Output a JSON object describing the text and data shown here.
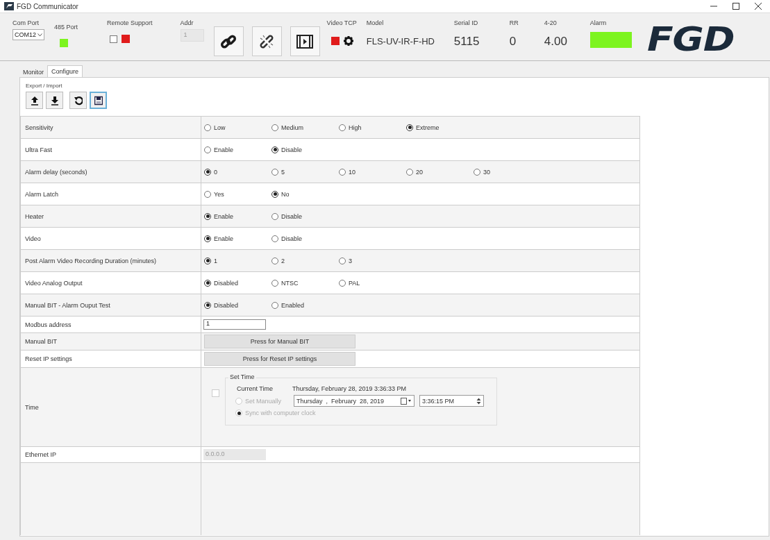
{
  "window": {
    "title": "FGD Communicator"
  },
  "toolbar": {
    "com_port": {
      "label": "Com Port",
      "value": "COM12"
    },
    "port_485": {
      "label": "485 Port",
      "on": true
    },
    "remote_support": {
      "label": "Remote Support",
      "checked": false,
      "on": false
    },
    "addr": {
      "label": "Addr",
      "value": "1",
      "disabled": true
    },
    "video_tcp": {
      "label": "Video TCP",
      "on": false
    },
    "model": {
      "label": "Model",
      "value": "FLS-UV-IR-F-HD"
    },
    "serial_id": {
      "label": "Serial ID",
      "value": "5115"
    },
    "rr": {
      "label": "RR",
      "value": "0"
    },
    "current": {
      "label": "4-20",
      "value": "4.00"
    },
    "alarm": {
      "label": "Alarm",
      "active": false
    },
    "logo": "FGD"
  },
  "tabs": [
    {
      "label": "Monitor",
      "selected": false
    },
    {
      "label": "Configure",
      "selected": true
    }
  ],
  "export_import": {
    "label": "Export / Import"
  },
  "settings": [
    {
      "kind": "radio",
      "label": "Sensitivity",
      "options": [
        {
          "label": "Low",
          "selected": false
        },
        {
          "label": "Medium",
          "selected": false
        },
        {
          "label": "High",
          "selected": false
        },
        {
          "label": "Extreme",
          "selected": true
        }
      ]
    },
    {
      "kind": "radio",
      "label": "Ultra Fast",
      "options": [
        {
          "label": "Enable",
          "selected": false
        },
        {
          "label": "Disable",
          "selected": true
        }
      ]
    },
    {
      "kind": "radio",
      "label": "Alarm delay (seconds)",
      "options": [
        {
          "label": "0",
          "selected": true
        },
        {
          "label": "5",
          "selected": false
        },
        {
          "label": "10",
          "selected": false
        },
        {
          "label": "20",
          "selected": false
        },
        {
          "label": "30",
          "selected": false
        }
      ]
    },
    {
      "kind": "radio",
      "label": "Alarm Latch",
      "options": [
        {
          "label": "Yes",
          "selected": false
        },
        {
          "label": "No",
          "selected": true
        }
      ]
    },
    {
      "kind": "radio",
      "label": "Heater",
      "options": [
        {
          "label": "Enable",
          "selected": true
        },
        {
          "label": "Disable",
          "selected": false
        }
      ]
    },
    {
      "kind": "radio",
      "label": "Video",
      "options": [
        {
          "label": "Enable",
          "selected": true
        },
        {
          "label": "Disable",
          "selected": false
        }
      ]
    },
    {
      "kind": "radio",
      "label": "Post Alarm Video Recording Duration (minutes)",
      "options": [
        {
          "label": "1",
          "selected": true
        },
        {
          "label": "2",
          "selected": false
        },
        {
          "label": "3",
          "selected": false
        }
      ]
    },
    {
      "kind": "radio",
      "label": "Video Analog Output",
      "options": [
        {
          "label": "Disabled",
          "selected": true
        },
        {
          "label": "NTSC",
          "selected": false
        },
        {
          "label": "PAL",
          "selected": false
        }
      ]
    },
    {
      "kind": "radio",
      "label": "Manual BIT - Alarm Ouput Test",
      "options": [
        {
          "label": "Disabled",
          "selected": true
        },
        {
          "label": "Enabled",
          "selected": false
        }
      ]
    },
    {
      "kind": "input",
      "label": "Modbus address",
      "value": "1"
    },
    {
      "kind": "button",
      "label": "Manual BIT",
      "button": "Press for Manual BIT"
    },
    {
      "kind": "button",
      "label": "Reset IP settings",
      "button": "Press for Reset IP settings"
    },
    {
      "kind": "time",
      "label": "Time",
      "checked": false,
      "group": "Set Time",
      "current_label": "Current Time",
      "current": "Thursday, February 28, 2019 3:36:33 PM",
      "manual": {
        "label": "Set Manually",
        "selected": false
      },
      "date": "Thursday  ,  February  28, 2019",
      "time": "3:36:15 PM",
      "sync": {
        "label": "Sync with computer clock",
        "selected": true
      }
    },
    {
      "kind": "ip",
      "label": "Ethernet IP",
      "value": "0.0.0.0",
      "disabled": true
    }
  ]
}
